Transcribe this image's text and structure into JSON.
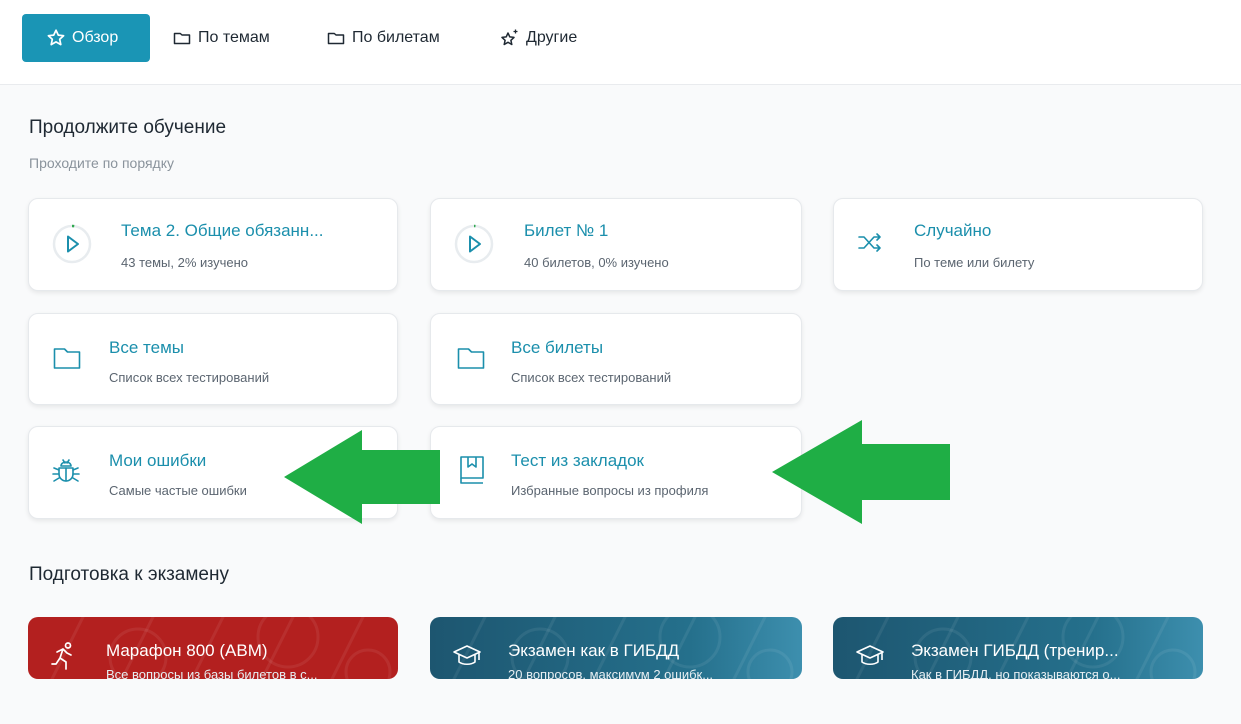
{
  "tabs": [
    {
      "label": "Обзор",
      "icon": "star-icon",
      "active": true
    },
    {
      "label": "По темам",
      "icon": "folder-icon",
      "active": false
    },
    {
      "label": "По билетам",
      "icon": "folder-icon",
      "active": false
    },
    {
      "label": "Другие",
      "icon": "sparkle-star-icon",
      "active": false
    }
  ],
  "continue_section": {
    "title": "Продолжите обучение",
    "subtitle": "Проходите по порядку",
    "cards": [
      {
        "title": "Тема 2. Общие обязанн...",
        "subtitle": "43 темы, 2% изучено",
        "icon": "play-progress-icon",
        "progress": 0.02
      },
      {
        "title": "Билет № 1",
        "subtitle": "40 билетов, 0% изучено",
        "icon": "play-progress-icon",
        "progress": 0.0
      },
      {
        "title": "Случайно",
        "subtitle": "По теме или билету",
        "icon": "shuffle-icon"
      },
      {
        "title": "Все темы",
        "subtitle": "Список всех тестирований",
        "icon": "folder-icon"
      },
      {
        "title": "Все билеты",
        "subtitle": "Список всех тестирований",
        "icon": "folder-icon"
      },
      {
        "title": "Мои ошибки",
        "subtitle": "Самые частые ошибки",
        "icon": "bug-icon"
      },
      {
        "title": "Тест из закладок",
        "subtitle": "Избранные вопросы из профиля",
        "icon": "bookmark-book-icon"
      }
    ]
  },
  "exam_section": {
    "title": "Подготовка к экзамену",
    "cards": [
      {
        "title": "Марафон 800 (ABM)",
        "subtitle": "Все вопросы из базы билетов в с...",
        "icon": "running-icon",
        "color": "#b3201f"
      },
      {
        "title": "Экзамен как в ГИБДД",
        "subtitle": "20 вопросов, максимум 2 ошибк...",
        "icon": "graduation-cap-icon",
        "color": "#1f5f78"
      },
      {
        "title": "Экзамен ГИБДД (тренир...",
        "subtitle": "Как в ГИБДД, но показываются о...",
        "icon": "graduation-cap-icon",
        "color": "#1f5f78"
      }
    ]
  },
  "annotation_arrows": [
    "green-arrow",
    "green-arrow"
  ],
  "colors": {
    "accent": "#1a95b5",
    "link": "#1b8fac",
    "arrow": "#1fae45",
    "marathon": "#b3201f",
    "exam": "#1f5f78"
  }
}
